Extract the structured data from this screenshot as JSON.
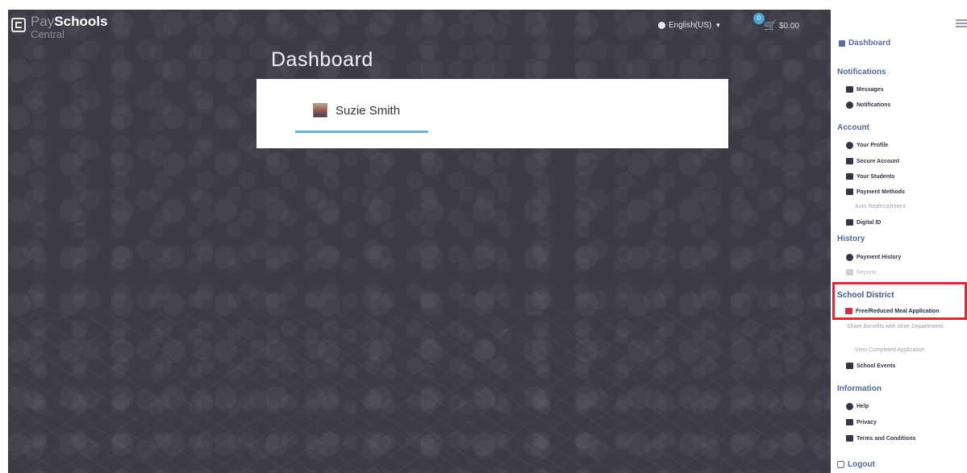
{
  "brand": {
    "pay": "Pay",
    "schools": "Schools",
    "sub": "Central"
  },
  "header": {
    "language": "English(US)",
    "cart_count": "0",
    "cart_total": "$0.00"
  },
  "main": {
    "title": "Dashboard",
    "user_name": "Suzie Smith"
  },
  "sidebar": {
    "dashboard": "Dashboard",
    "notifications": {
      "title": "Notifications",
      "items": [
        "Messages",
        "Notifications"
      ]
    },
    "account": {
      "title": "Account",
      "items": [
        "Your Profile",
        "Secure Account",
        "Your Students",
        "Payment Methods",
        "Auto Replenishment",
        "Digital ID"
      ]
    },
    "history": {
      "title": "History",
      "items": [
        "Payment History",
        "Reports"
      ]
    },
    "school_district": {
      "title": "School District",
      "items": [
        "Free/Reduced Meal Application",
        "Share Benefits with other Departments",
        "View Completed Application",
        "School Events"
      ]
    },
    "information": {
      "title": "Information",
      "items": [
        "Help",
        "Privacy",
        "Terms and Conditions"
      ]
    },
    "logout": "Logout"
  },
  "colors": {
    "background": "#3d3b45",
    "accent": "#6fb1d6",
    "highlight": "#d92a3a",
    "nav_heading": "#4f6b96"
  },
  "icons": {
    "globe": "globe-icon",
    "cart": "cart-icon",
    "menu": "hamburger-icon"
  }
}
